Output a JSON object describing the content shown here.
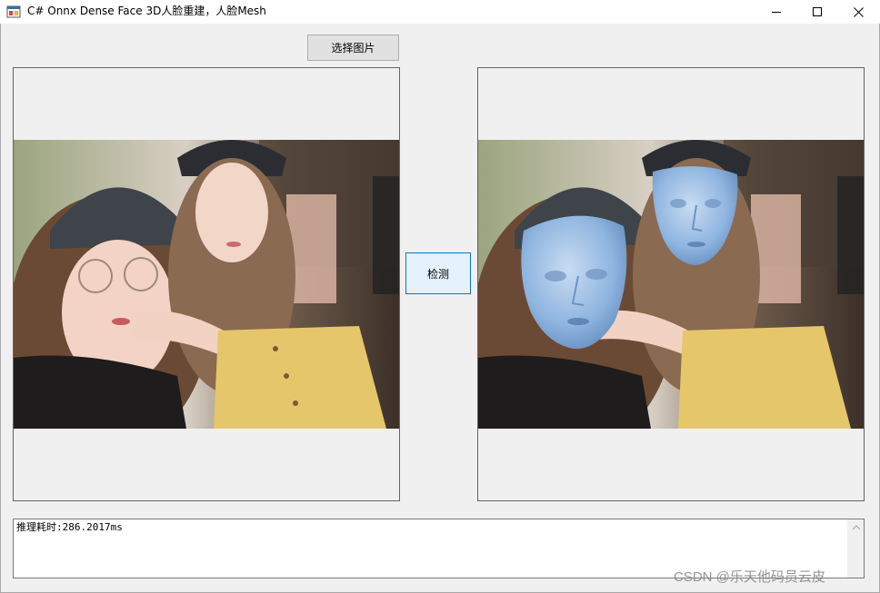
{
  "window": {
    "title": "C# Onnx  Dense Face 3D人脸重建，人脸Mesh",
    "app_icon": "winforms-app-icon",
    "controls": {
      "minimize_icon": "minimize-icon",
      "maximize_icon": "maximize-icon",
      "close_icon": "close-icon"
    }
  },
  "toolbar": {
    "select_image_label": "选择图片"
  },
  "actions": {
    "detect_label": "检测"
  },
  "images": {
    "input": "photo of two young women wearing caps, original",
    "output": "same photo with blue 3D face meshes overlaid on both faces"
  },
  "output_log": {
    "text": "推理耗时:286.2017ms"
  },
  "watermark": {
    "text": "CSDN @乐天他码员云皮"
  },
  "colors": {
    "window_bg": "#f0f0f0",
    "focus_border": "#0078d7",
    "mesh_blue": "#8fb5e0"
  }
}
